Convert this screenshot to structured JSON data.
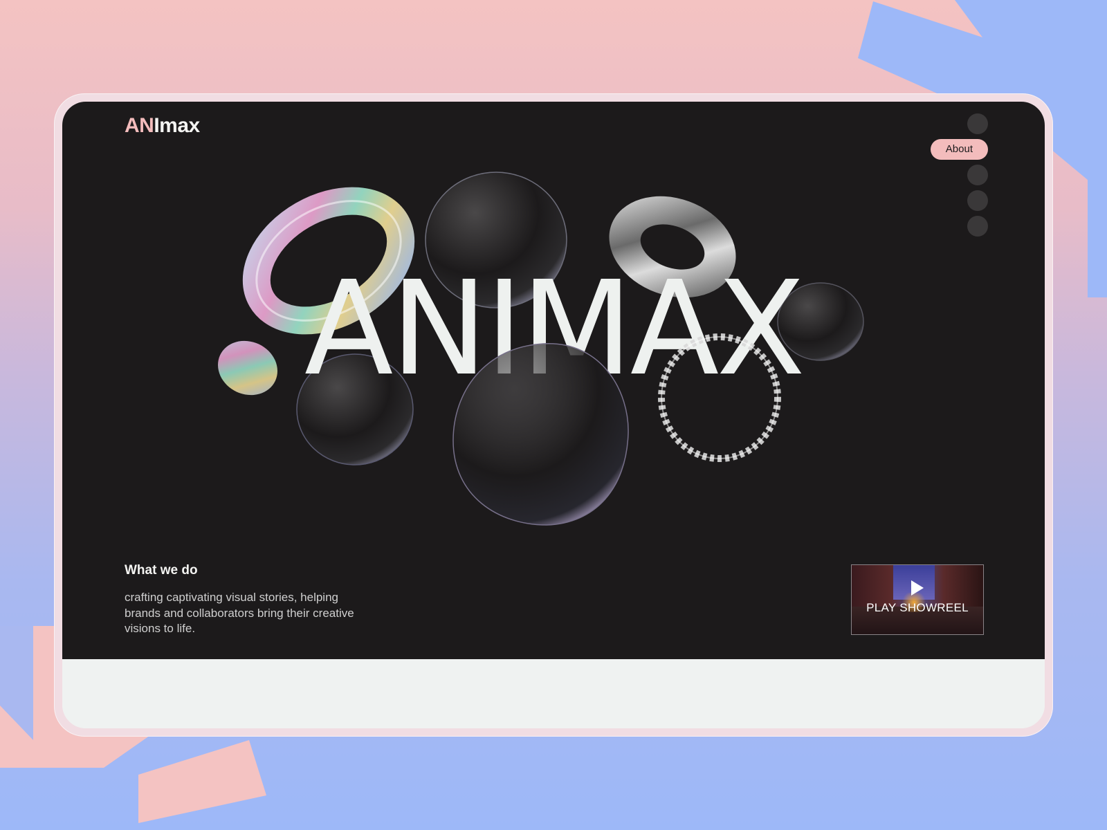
{
  "brand": {
    "logo_accent": "AN",
    "logo_rest": "Imax"
  },
  "nav": {
    "items": [
      {
        "label": "",
        "icon": "dot"
      },
      {
        "label": "About",
        "active": true
      },
      {
        "label": "",
        "icon": "dot"
      },
      {
        "label": "",
        "icon": "dot"
      },
      {
        "label": "",
        "icon": "dot"
      }
    ]
  },
  "hero": {
    "title": "ANIMAX"
  },
  "what_we_do": {
    "heading": "What we do",
    "body": "crafting captivating visual stories, helping brands and collaborators bring their creative visions to life."
  },
  "showreel": {
    "label": "PLAY SHOWREEL",
    "icon": "play-icon"
  },
  "colors": {
    "hero_bg": "#1c1a1b",
    "accent_pink": "#f3bcbc",
    "footer_bg": "#eff2f1",
    "bg_pink": "#f4c3c2",
    "bg_blue": "#9db8f8"
  }
}
